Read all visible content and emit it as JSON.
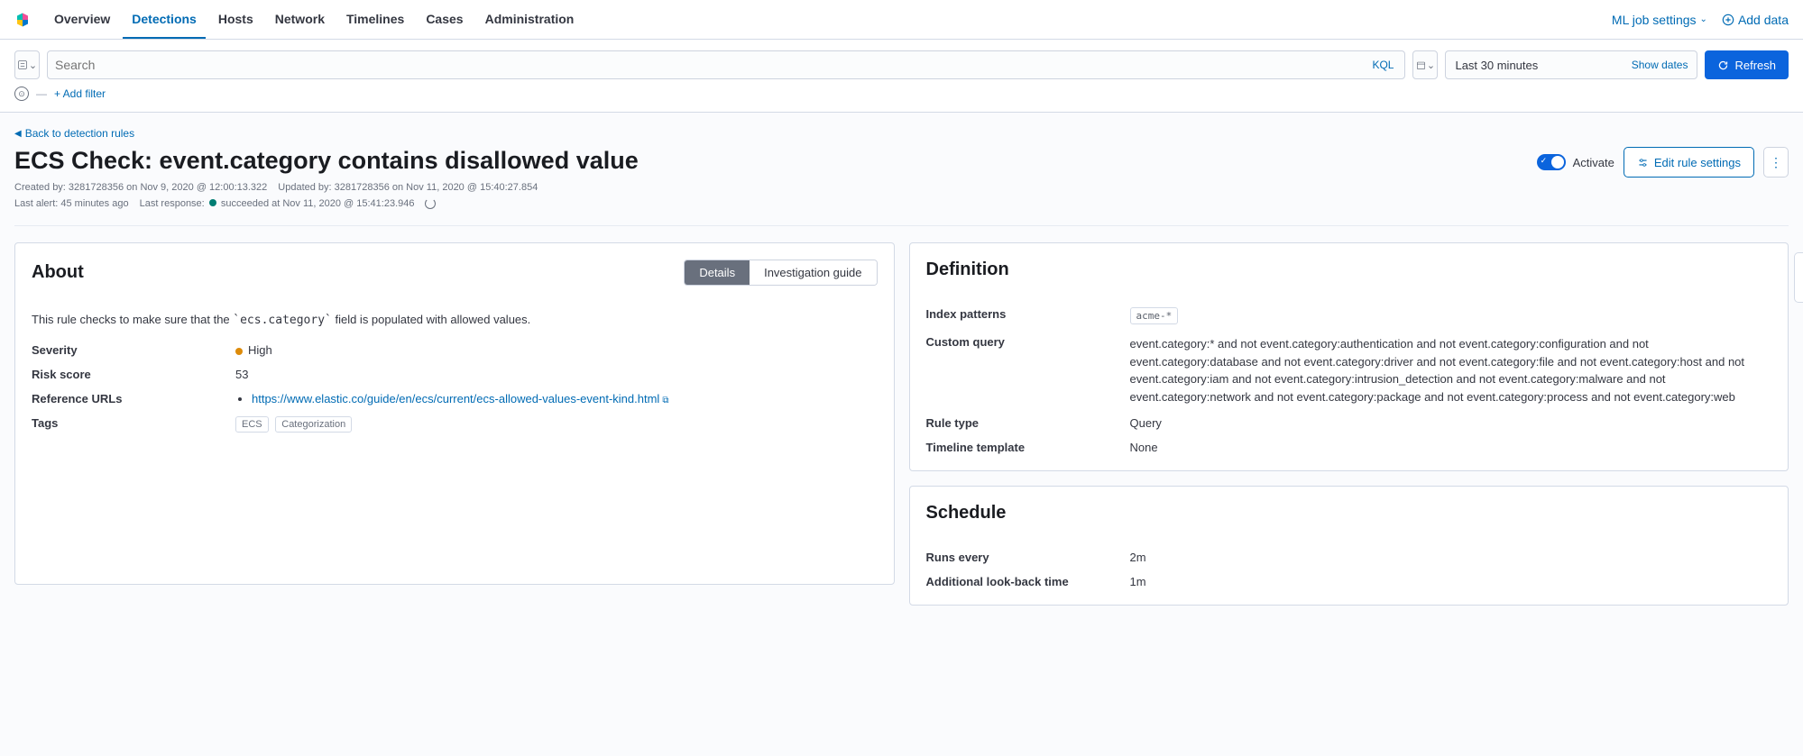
{
  "nav": {
    "tabs": [
      "Overview",
      "Detections",
      "Hosts",
      "Network",
      "Timelines",
      "Cases",
      "Administration"
    ],
    "ml_link": "ML job settings",
    "add_data": "Add data"
  },
  "query": {
    "placeholder": "Search",
    "kql": "KQL",
    "date_range": "Last 30 minutes",
    "show_dates": "Show dates",
    "refresh": "Refresh",
    "add_filter": "+ Add filter"
  },
  "header": {
    "back": "Back to detection rules",
    "title": "ECS Check: event.category contains disallowed value",
    "created_by": "Created by: 3281728356 on Nov 9, 2020 @ 12:00:13.322",
    "updated_by": "Updated by: 3281728356 on Nov 11, 2020 @ 15:40:27.854",
    "last_alert": "Last alert: 45 minutes ago",
    "last_response": "Last response:",
    "last_response_val": "succeeded at Nov 11, 2020 @ 15:41:23.946",
    "activate": "Activate",
    "edit": "Edit rule settings"
  },
  "about": {
    "title": "About",
    "tab_details": "Details",
    "tab_guide": "Investigation guide",
    "desc_pre": "This rule checks to make sure that the ",
    "desc_code": "`ecs.category`",
    "desc_post": " field is populated with allowed values.",
    "fields": {
      "severity_label": "Severity",
      "severity_value": "High",
      "risk_label": "Risk score",
      "risk_value": "53",
      "ref_label": "Reference URLs",
      "ref_url": "https://www.elastic.co/guide/en/ecs/current/ecs-allowed-values-event-kind.html",
      "tags_label": "Tags",
      "tags": [
        "ECS",
        "Categorization"
      ]
    }
  },
  "definition": {
    "title": "Definition",
    "index_label": "Index patterns",
    "index_value": "acme-*",
    "query_label": "Custom query",
    "query_value": "event.category:* and not event.category:authentication and not event.category:configuration and not event.category:database and not event.category:driver and not event.category:file and not event.category:host and not event.category:iam and not event.category:intrusion_detection and not event.category:malware and not event.category:network and not event.category:package and not event.category:process and not event.category:web",
    "type_label": "Rule type",
    "type_value": "Query",
    "timeline_label": "Timeline template",
    "timeline_value": "None"
  },
  "schedule": {
    "title": "Schedule",
    "runs_label": "Runs every",
    "runs_value": "2m",
    "lookback_label": "Additional look-back time",
    "lookback_value": "1m"
  }
}
